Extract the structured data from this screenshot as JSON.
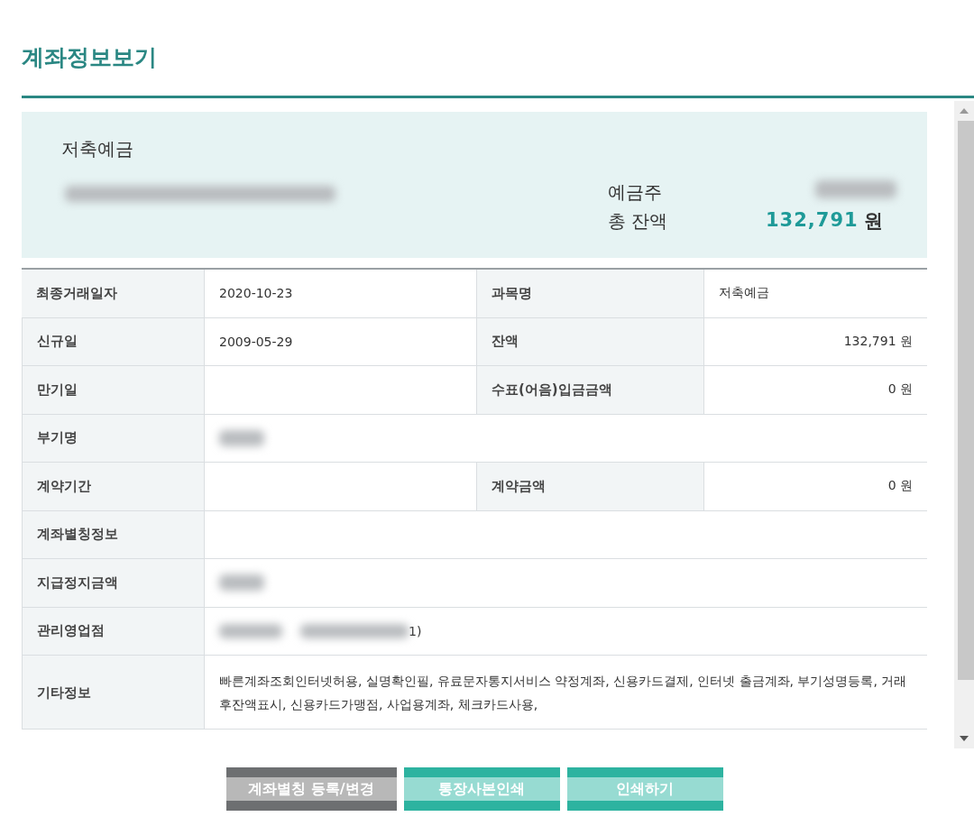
{
  "title": "계좌정보보기",
  "summary": {
    "product": "저축예금",
    "account_number": {
      "kind": "redacted"
    },
    "depositor_label": "예금주",
    "depositor": {
      "kind": "redacted"
    },
    "balance_label": "총 잔액",
    "balance": "132,791",
    "currency": "원"
  },
  "rows": [
    {
      "cells": [
        {
          "kind": "label",
          "text": "최종거래일자"
        },
        {
          "kind": "value",
          "text": "2020-10-23"
        },
        {
          "kind": "label",
          "text": "과목명"
        },
        {
          "kind": "value",
          "text": "저축예금"
        }
      ]
    },
    {
      "cells": [
        {
          "kind": "label",
          "text": "신규일"
        },
        {
          "kind": "value",
          "text": "2009-05-29"
        },
        {
          "kind": "label",
          "text": "잔액"
        },
        {
          "kind": "amount",
          "text": "132,791 원"
        }
      ]
    },
    {
      "cells": [
        {
          "kind": "label",
          "text": "만기일"
        },
        {
          "kind": "empty"
        },
        {
          "kind": "label",
          "text": "수표(어음)입금금액"
        },
        {
          "kind": "amount",
          "text": "0 원"
        }
      ]
    },
    {
      "cells": [
        {
          "kind": "label",
          "text": "부기명"
        },
        {
          "kind": "redacted"
        }
      ]
    },
    {
      "cells": [
        {
          "kind": "label",
          "text": "계약기간"
        },
        {
          "kind": "empty"
        },
        {
          "kind": "label",
          "text": "계약금액"
        },
        {
          "kind": "amount",
          "text": "0 원"
        }
      ]
    },
    {
      "cells": [
        {
          "kind": "label",
          "text": "계좌별칭정보"
        },
        {
          "kind": "empty"
        }
      ]
    },
    {
      "cells": [
        {
          "kind": "label",
          "text": "지급정지금액"
        },
        {
          "kind": "redacted"
        }
      ]
    },
    {
      "cells": [
        {
          "kind": "label",
          "text": "관리영업점"
        },
        {
          "kind": "partly_redacted",
          "text": "1)"
        }
      ]
    },
    {
      "cells": [
        {
          "kind": "label",
          "text": "기타정보"
        },
        {
          "kind": "value",
          "text": "빠른계좌조회인터넷허용,  실명확인필,  유료문자통지서비스 약정계좌,  신용카드결제,  인터넷 출금계좌,  부기성명등록,  거래후잔액표시,  신용카드가맹점,  사업용계좌,  체크카드사용,"
        }
      ]
    }
  ],
  "buttons": [
    {
      "label": "계좌별칭 등록/변경",
      "kind": "secondary"
    },
    {
      "label": "통장사본인쇄",
      "kind": "primary"
    },
    {
      "label": "인쇄하기",
      "kind": "primary"
    }
  ]
}
